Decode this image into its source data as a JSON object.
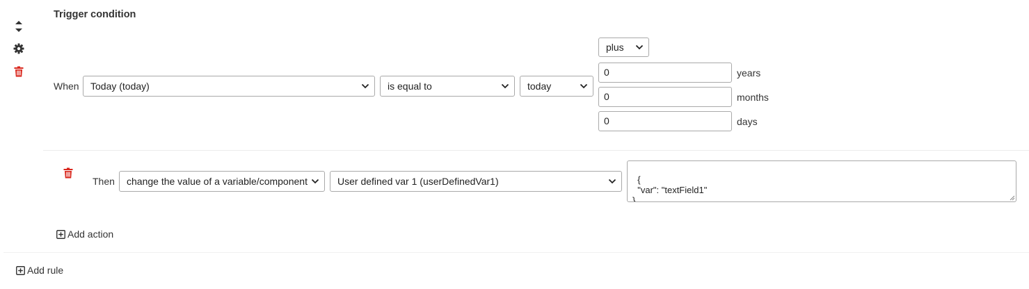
{
  "rule": {
    "title": "Trigger condition",
    "icons": [
      "sort-icon",
      "gear-icon",
      "trash-icon"
    ],
    "when_label": "When",
    "field_select": "Today (today)",
    "operator_select": "is equal to",
    "value_select": "today",
    "offset_select": "plus",
    "years": {
      "value": "0",
      "unit": "years"
    },
    "months": {
      "value": "0",
      "unit": "months"
    },
    "days": {
      "value": "0",
      "unit": "days"
    }
  },
  "action": {
    "then_label": "Then",
    "action_select": "change the value of a variable/component",
    "target_select": "User defined var 1 (userDefinedVar1)",
    "json_value": "{\n  \"var\": \"textField1\"\n}",
    "add_action_label": "Add action"
  },
  "footer": {
    "add_rule_label": "Add rule"
  },
  "colors": {
    "danger": "#d9261c",
    "icon": "#333333",
    "border": "#a9a9a9"
  }
}
